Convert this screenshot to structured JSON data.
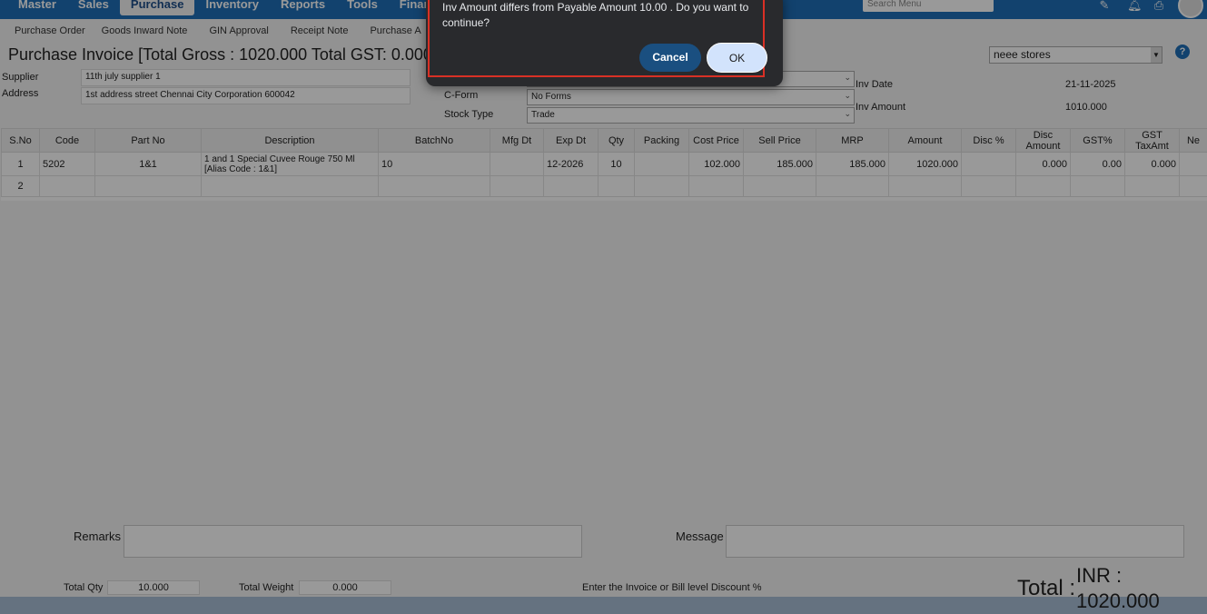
{
  "nav": {
    "items": [
      "Master",
      "Sales",
      "Purchase",
      "Inventory",
      "Reports",
      "Tools",
      "Finance And A"
    ],
    "active": "Purchase",
    "search_placeholder": "Search Menu"
  },
  "subnav": {
    "items": [
      "Purchase Order",
      "Goods Inward Note",
      "GIN Approval",
      "Receipt Note",
      "Purchase A"
    ]
  },
  "page": {
    "title": "Purchase Invoice [Total Gross : 1020.000 Total GST: 0.000]",
    "store": "neee stores",
    "help": "?"
  },
  "form": {
    "supplier_label": "Supplier",
    "supplier_value": "11th july supplier 1",
    "address_label": "Address",
    "address_value": "1st address street Chennai City Corporation 600042",
    "cform_label": "C-Form",
    "cform_value": "No Forms",
    "stocktype_label": "Stock Type",
    "stocktype_value": "Trade",
    "invdate_label": "Inv Date",
    "invdate_value": "21-11-2025",
    "invamount_label": "Inv Amount",
    "invamount_value": "1010.000"
  },
  "grid": {
    "columns": [
      "S.No",
      "Code",
      "Part No",
      "Description",
      "BatchNo",
      "Mfg Dt",
      "Exp Dt",
      "Qty",
      "Packing",
      "Cost Price",
      "Sell Price",
      "MRP",
      "Amount",
      "Disc %",
      "Disc Amount",
      "GST%",
      "GST TaxAmt",
      "Ne"
    ],
    "rows": [
      {
        "sno": "1",
        "code": "5202",
        "partno": "1&1",
        "description": "1 and 1 Special Cuvee Rouge 750 Ml [Alias Code : 1&1]",
        "batch": "10",
        "mfg": "",
        "exp": "12-2026",
        "qty": "10",
        "packing": "",
        "cost": "102.000",
        "sell": "185.000",
        "mrp": "185.000",
        "amount": "1020.000",
        "discpct": "",
        "discamt": "0.000",
        "gstpct": "0.00",
        "gsttax": "0.000",
        "ne": ""
      },
      {
        "sno": "2",
        "code": "",
        "partno": "",
        "description": "",
        "batch": "",
        "mfg": "",
        "exp": "",
        "qty": "",
        "packing": "",
        "cost": "",
        "sell": "",
        "mrp": "",
        "amount": "",
        "discpct": "",
        "discamt": "",
        "gstpct": "",
        "gsttax": "",
        "ne": ""
      }
    ]
  },
  "bottom": {
    "remarks_label": "Remarks",
    "message_label": "Message",
    "total_qty_label": "Total Qty",
    "total_qty_value": "10.000",
    "total_weight_label": "Total Weight",
    "total_weight_value": "0.000",
    "discount_hint": "Enter the Invoice or Bill level Discount %",
    "total_label": "Total :",
    "total_value": "INR : 1020.000"
  },
  "dialog": {
    "message": "Inv Amount differs from Payable Amount 10.00 . Do you want to continue?",
    "cancel": "Cancel",
    "ok": "OK"
  },
  "colors": {
    "nav_bg": "#1f6fb8",
    "dialog_bg": "#292a2d",
    "cancel_bg": "#1a4f80",
    "ok_bg": "#d2e3fc",
    "highlight": "#d93025"
  }
}
